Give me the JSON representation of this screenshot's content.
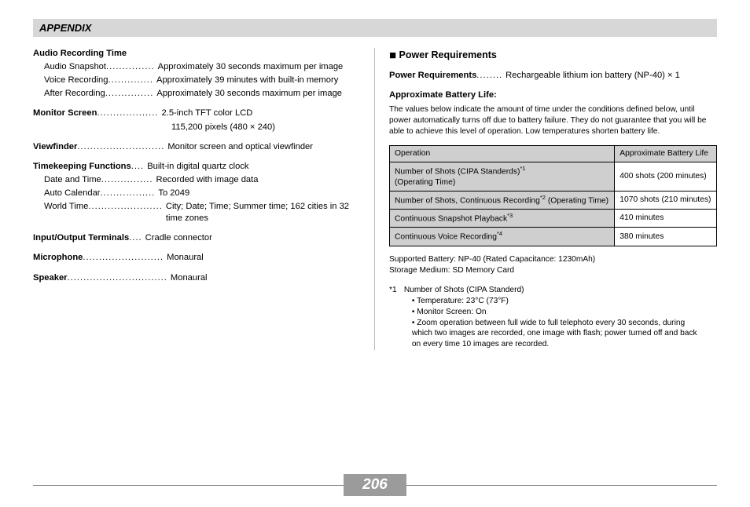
{
  "header": "APPENDIX",
  "left": {
    "audio_heading": "Audio Recording Time",
    "audio": [
      {
        "label": "Audio Snapshot",
        "dots": "...............",
        "val": "Approximately 30 seconds maximum per image"
      },
      {
        "label": "Voice Recording",
        "dots": "..............",
        "val": "Approximately 39 minutes with built-in memory"
      },
      {
        "label": "After Recording",
        "dots": "...............",
        "val": "Approximately 30 seconds maximum per image"
      }
    ],
    "monitor_label": "Monitor Screen",
    "monitor_dots": "...................",
    "monitor_val": "2.5-inch TFT color LCD",
    "monitor_val2": "115,200 pixels (480 × 240)",
    "viewfinder_label": "Viewfinder",
    "viewfinder_dots": "...........................",
    "viewfinder_val": "Monitor screen and optical viewfinder",
    "timekeep_label": "Timekeeping Functions",
    "timekeep_dots": "....",
    "timekeep_val": "Built-in digital quartz clock",
    "timekeep_rows": [
      {
        "label": "Date and Time",
        "dots": "................",
        "val": "Recorded with image data"
      },
      {
        "label": "Auto Calendar",
        "dots": ".................",
        "val": "To 2049"
      },
      {
        "label": "World Time",
        "dots": ".......................",
        "val": "City; Date; Time; Summer time; 162 cities in 32 time zones"
      }
    ],
    "io_label": "Input/Output Terminals",
    "io_dots": "....",
    "io_val": "Cradle connector",
    "mic_label": "Microphone",
    "mic_dots": ".........................",
    "mic_val": "Monaural",
    "spk_label": "Speaker",
    "spk_dots": "...............................",
    "spk_val": "Monaural"
  },
  "right": {
    "section_title": "Power Requirements",
    "pr_label": "Power Requirements",
    "pr_dots": "........",
    "pr_val": "Rechargeable lithium ion battery (NP-40) × 1",
    "bat_heading": "Approximate Battery Life:",
    "bat_desc": "The values below indicate the amount of time under the conditions defined below, until power automatically turns off due to battery failure. They do not guarantee that you will be able to achieve this level of operation. Low temperatures shorten battery life.",
    "table": {
      "h1": "Operation",
      "h2": "Approximate Battery Life",
      "rows": [
        {
          "op": "Number of Shots (CIPA Standerds)",
          "sup": "*1",
          "op2": "(Operating Time)",
          "val": "400 shots (200 minutes)"
        },
        {
          "op": "Number of Shots, Continuous Recording",
          "sup": "*2",
          "op2": " (Operating Time)",
          "val": "1070 shots (210 minutes)"
        },
        {
          "op": "Continuous Snapshot Playback",
          "sup": "*3",
          "op2": "",
          "val": "410 minutes"
        },
        {
          "op": "Continuous Voice Recording",
          "sup": "*4",
          "op2": "",
          "val": "380 minutes"
        }
      ]
    },
    "support1": "Supported Battery: NP-40 (Rated Capacitance: 1230mAh)",
    "support2": "Storage Medium: SD Memory Card",
    "fn_label": "*1",
    "fn_title": "Number of Shots (CIPA Standerd)",
    "fn_bullets": [
      "Temperature: 23°C (73°F)",
      "Monitor Screen: On",
      "Zoom operation between full wide to full telephoto every 30 seconds, during which two images are recorded, one image with flash; power turned off and back on every time 10 images are recorded."
    ]
  },
  "page_number": "206"
}
